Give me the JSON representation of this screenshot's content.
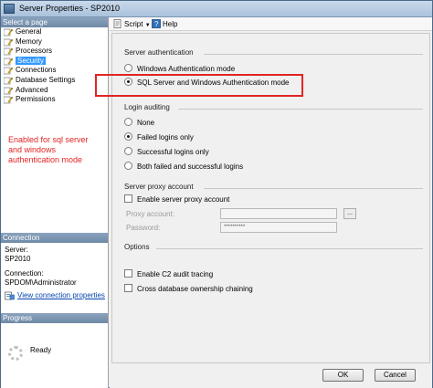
{
  "window": {
    "title": "Server Properties - SP2010"
  },
  "left_pane": {
    "select_page_header": "Select a page",
    "pages": [
      {
        "label": "General",
        "selected": false
      },
      {
        "label": "Memory",
        "selected": false
      },
      {
        "label": "Processors",
        "selected": false
      },
      {
        "label": "Security",
        "selected": true
      },
      {
        "label": "Connections",
        "selected": false
      },
      {
        "label": "Database Settings",
        "selected": false
      },
      {
        "label": "Advanced",
        "selected": false
      },
      {
        "label": "Permissions",
        "selected": false
      }
    ],
    "connection_header": "Connection",
    "server_label": "Server:",
    "server_value": "SP2010",
    "connection_label": "Connection:",
    "connection_value": "SPDOM\\Administrator",
    "view_connection_link": "View connection properties",
    "progress_header": "Progress",
    "progress_status": "Ready"
  },
  "toolbar": {
    "script_label": "Script",
    "help_label": "Help"
  },
  "security": {
    "server_auth_header": "Server authentication",
    "windows_auth_label": "Windows Authentication mode",
    "sql_windows_auth_label": "SQL Server and Windows Authentication mode",
    "selected_auth": "sql_windows",
    "login_auditing_header": "Login auditing",
    "audit_options": [
      {
        "label": "None",
        "selected": false
      },
      {
        "label": "Failed logins only",
        "selected": true
      },
      {
        "label": "Successful logins only",
        "selected": false
      },
      {
        "label": "Both failed and successful logins",
        "selected": false
      }
    ],
    "proxy_header": "Server proxy account",
    "enable_proxy_label": "Enable server proxy account",
    "enable_proxy_checked": false,
    "proxy_account_label": "Proxy account:",
    "proxy_account_value": "",
    "password_label": "Password:",
    "password_value": "**********",
    "browse_label": "...",
    "options_header": "Options",
    "c2_audit_label": "Enable C2 audit tracing",
    "c2_audit_checked": false,
    "cross_db_label": "Cross database ownership chaining",
    "cross_db_checked": false
  },
  "annotation": {
    "text": "Enabled for sql server and windows authentication mode",
    "color": "#e22424"
  },
  "buttons": {
    "ok_label": "OK",
    "cancel_label": "Cancel"
  }
}
